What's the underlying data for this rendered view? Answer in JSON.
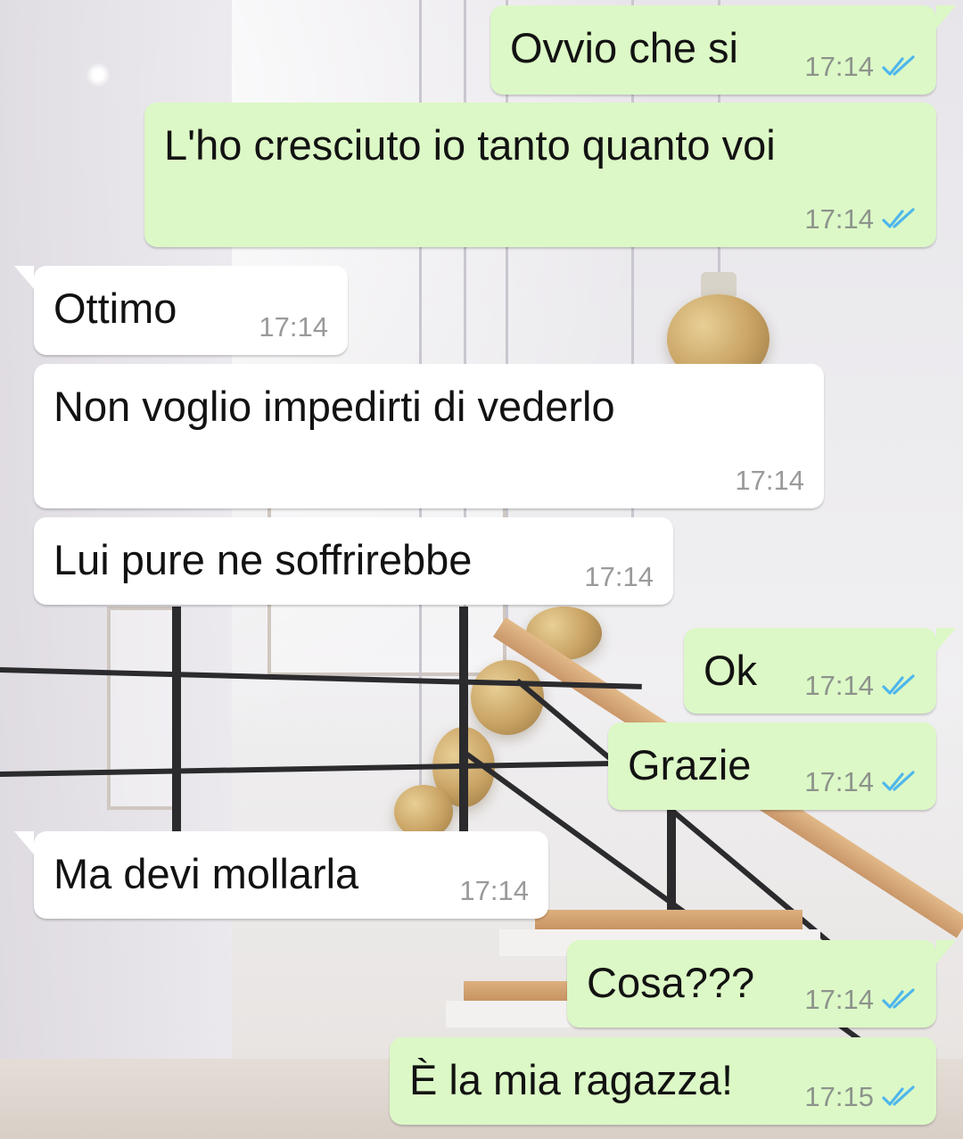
{
  "colors": {
    "outgoing_bubble": "#dcf8c6",
    "incoming_bubble": "#ffffff",
    "read_ticks": "#4fb6ec",
    "timestamp": "#8d938c"
  },
  "messages": [
    {
      "direction": "outgoing",
      "text": "Ovvio che si",
      "time": "17:14",
      "status": "read"
    },
    {
      "direction": "outgoing",
      "text": "L'ho cresciuto io tanto quanto voi",
      "time": "17:14",
      "status": "read"
    },
    {
      "direction": "incoming",
      "text": "Ottimo",
      "time": "17:14"
    },
    {
      "direction": "incoming",
      "text": "Non voglio impedirti di vederlo",
      "time": "17:14"
    },
    {
      "direction": "incoming",
      "text": "Lui pure ne soffrirebbe",
      "time": "17:14"
    },
    {
      "direction": "outgoing",
      "text": "Ok",
      "time": "17:14",
      "status": "read"
    },
    {
      "direction": "outgoing",
      "text": "Grazie",
      "time": "17:14",
      "status": "read"
    },
    {
      "direction": "incoming",
      "text": "Ma devi mollarla",
      "time": "17:14"
    },
    {
      "direction": "outgoing",
      "text": "Cosa???",
      "time": "17:14",
      "status": "read"
    },
    {
      "direction": "outgoing",
      "text": "È la mia ragazza!",
      "time": "17:15",
      "status": "read"
    }
  ]
}
